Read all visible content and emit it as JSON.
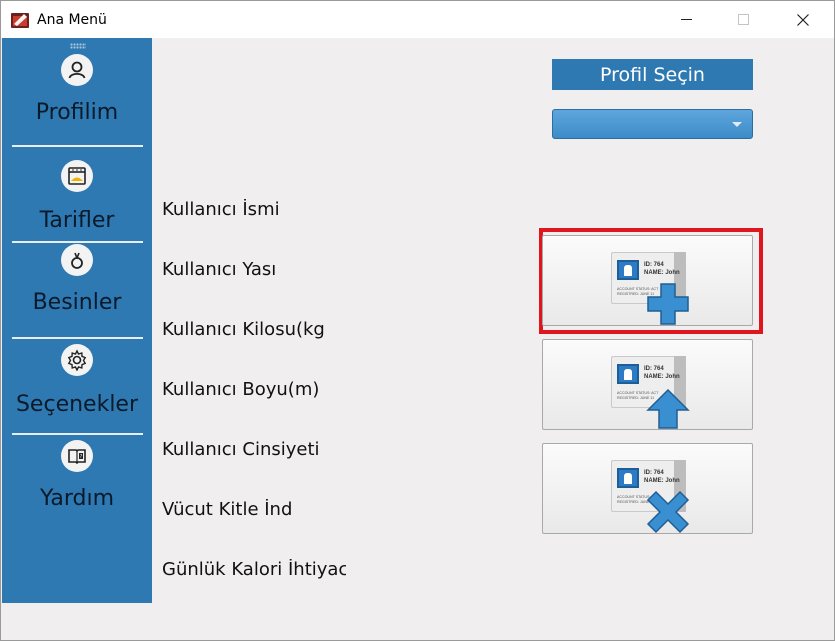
{
  "window": {
    "title": "Ana Menü"
  },
  "sidebar": {
    "items": [
      {
        "label": "Profilim",
        "icon": "user-icon"
      },
      {
        "label": "Tarifler",
        "icon": "recipes-icon"
      },
      {
        "label": "Besinler",
        "icon": "food-icon"
      },
      {
        "label": "Seçenekler",
        "icon": "gear-icon"
      },
      {
        "label": "Yardım",
        "icon": "help-book-icon"
      }
    ]
  },
  "profile": {
    "header": "Profil Seçin",
    "selected": ""
  },
  "fields": [
    "Kullanıcı İsmi",
    "Kullanıcı Yası",
    "Kullanıcı Kilosu(kg",
    "Kullanıcı Boyu(m)",
    "Kullanıcı Cinsiyeti",
    "Vücut Kitle İnd",
    "Günlük Kalori İhtiyac"
  ],
  "card": {
    "id": "ID: 764",
    "name": "NAME: John",
    "status": "ACCOUNT STATUS: ACT",
    "registered": "REGISTRED: JUNE 11"
  },
  "actions": [
    {
      "icon": "add-profile-icon"
    },
    {
      "icon": "update-profile-icon"
    },
    {
      "icon": "delete-profile-icon"
    }
  ],
  "colors": {
    "sidebar": "#2e79b2",
    "highlight": "#e0161e",
    "accent": "#3a8fd0"
  }
}
